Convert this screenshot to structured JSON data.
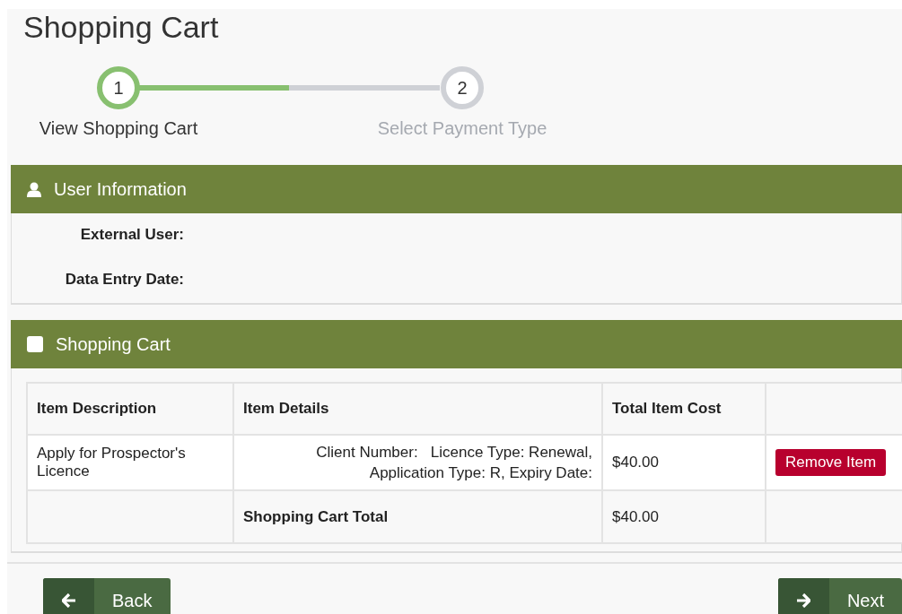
{
  "title": "Shopping Cart",
  "stepper": {
    "level": 0.5,
    "steps": [
      {
        "number": "1",
        "label": "View Shopping Cart",
        "selected": true
      },
      {
        "number": "2",
        "label": "Select Payment Type",
        "selected": false
      }
    ]
  },
  "user_information": {
    "title": "User Information",
    "fields": [
      {
        "label": "External User:"
      },
      {
        "label": "Data Entry Date:"
      }
    ]
  },
  "shopping_cart": {
    "title": "Shopping Cart",
    "columns": [
      "Item Description",
      "Item Details",
      "Total Item Cost"
    ],
    "rows": [
      {
        "kind": "item",
        "description": "Apply for Prospector's Licence",
        "details_line_1": "Client Number:   Licence Type: Renewal,",
        "details_line_2": "Application Type: R, Expiry Date:",
        "cost": "$40.00",
        "action": "Remove Item"
      },
      {
        "kind": "total",
        "label": "Shopping Cart Total",
        "cost": "$40.00"
      }
    ]
  },
  "buttons": [
    {
      "label": "Back",
      "kind": "back"
    },
    {
      "label": "Next",
      "kind": "next"
    }
  ]
}
